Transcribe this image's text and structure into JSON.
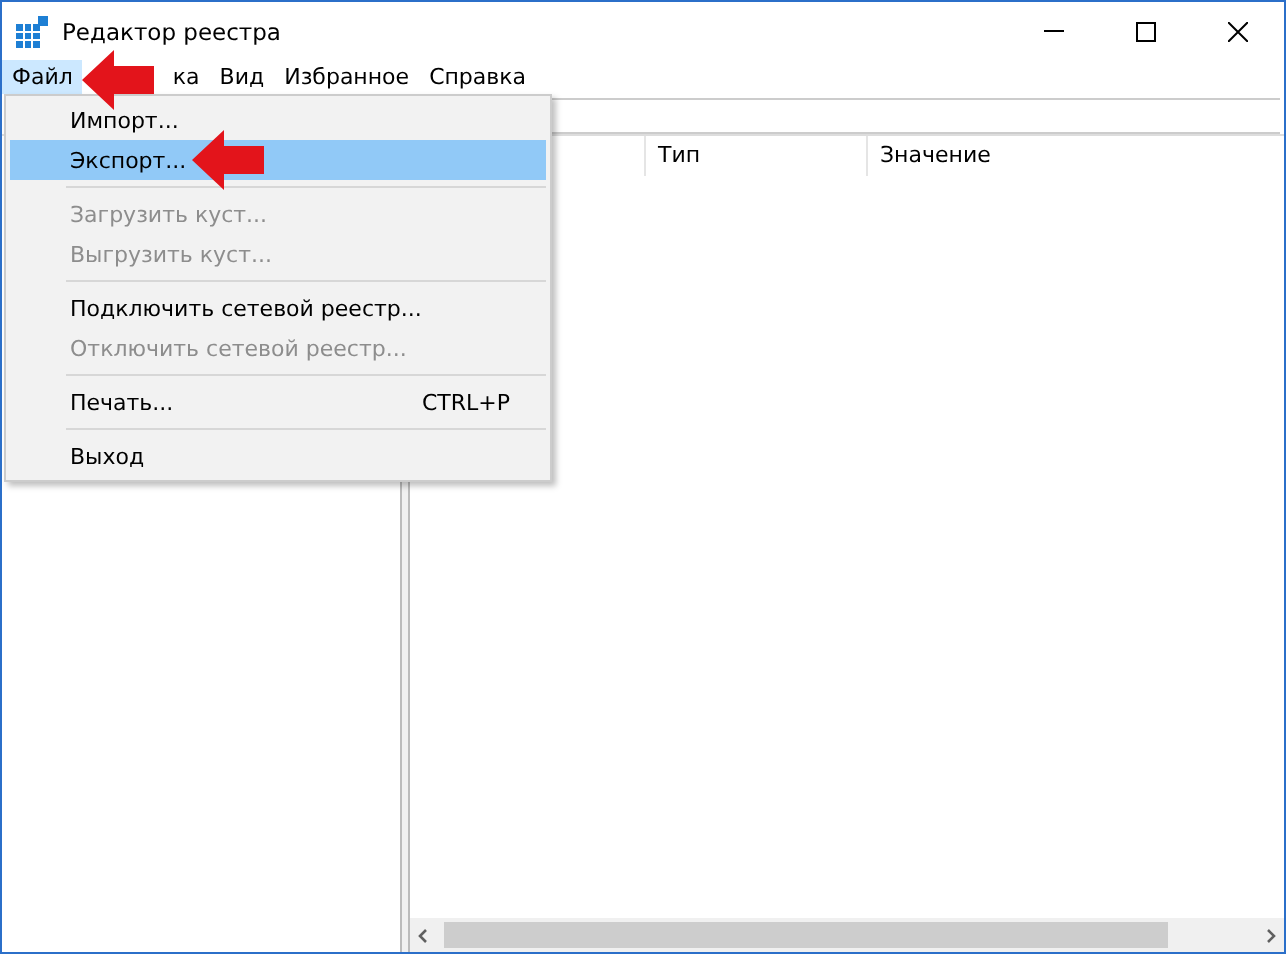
{
  "window": {
    "title": "Редактор реестра"
  },
  "menu_bar": [
    {
      "label": "Файл",
      "selected": true
    },
    {
      "label": "ка",
      "selected": false
    },
    {
      "label": "Вид",
      "selected": false
    },
    {
      "label": "Избранное",
      "selected": false
    },
    {
      "label": "Справка",
      "selected": false
    }
  ],
  "file_menu": [
    {
      "kind": "item",
      "label": "Импорт...",
      "disabled": false,
      "selected": false
    },
    {
      "kind": "item",
      "label": "Экспорт...",
      "disabled": false,
      "selected": true
    },
    {
      "kind": "separator"
    },
    {
      "kind": "item",
      "label": "Загрузить куст...",
      "disabled": true,
      "selected": false
    },
    {
      "kind": "item",
      "label": "Выгрузить куст...",
      "disabled": true,
      "selected": false
    },
    {
      "kind": "separator"
    },
    {
      "kind": "item",
      "label": "Подключить сетевой реестр...",
      "disabled": false,
      "selected": false
    },
    {
      "kind": "item",
      "label": "Отключить сетевой реестр...",
      "disabled": true,
      "selected": false
    },
    {
      "kind": "separator"
    },
    {
      "kind": "item",
      "label": "Печать...",
      "shortcut": "CTRL+P",
      "disabled": false,
      "selected": false
    },
    {
      "kind": "separator"
    },
    {
      "kind": "item",
      "label": "Выход",
      "disabled": false,
      "selected": false
    }
  ],
  "table": {
    "columns": [
      "Тип",
      "Значение"
    ]
  }
}
